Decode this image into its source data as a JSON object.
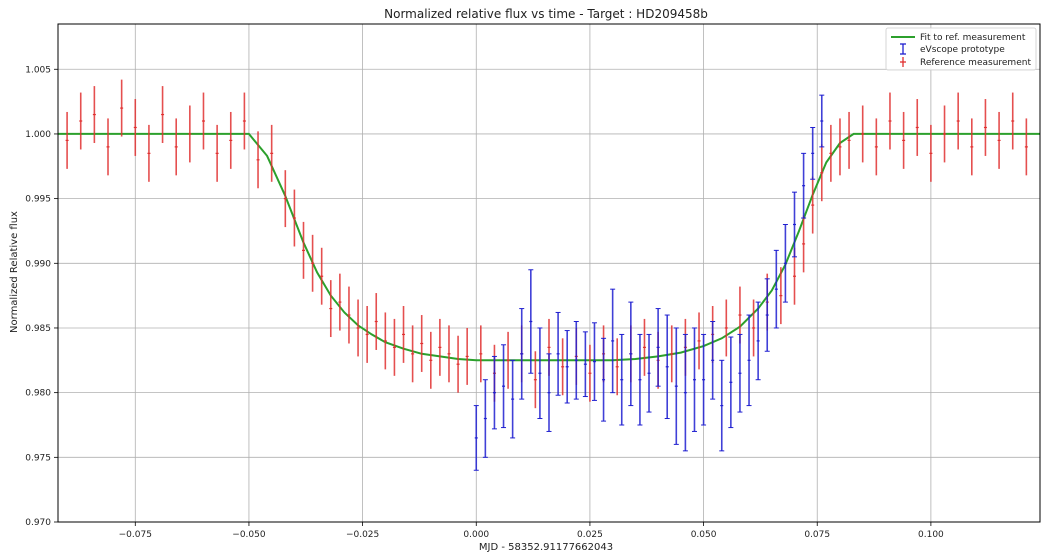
{
  "chart_data": {
    "type": "scatter",
    "title": "Normalized relative flux vs time - Target : HD209458b",
    "xlabel": "MJD - 58352.91177662043",
    "ylabel": "Normalized Relative flux",
    "xlim": [
      -0.092,
      0.124
    ],
    "ylim": [
      0.97,
      1.0085
    ],
    "xticks": [
      -0.075,
      -0.05,
      -0.025,
      0.0,
      0.025,
      0.05,
      0.075,
      0.1
    ],
    "xtick_labels": [
      "−0.075",
      "−0.050",
      "−0.025",
      "0.000",
      "0.025",
      "0.050",
      "0.075",
      "0.100"
    ],
    "yticks": [
      0.97,
      0.975,
      0.98,
      0.985,
      0.99,
      0.995,
      1.0,
      1.005
    ],
    "ytick_labels": [
      "0.970",
      "0.975",
      "0.980",
      "0.985",
      "0.990",
      "0.995",
      "1.000",
      "1.005"
    ],
    "grid": true,
    "legend_position": "top-right",
    "colors": {
      "fit": "#2ca02c",
      "eVscope": "#1f1fd0",
      "reference": "#e03030"
    },
    "series": [
      {
        "name": "Fit to ref. measurement",
        "style": "line",
        "x": [
          -0.092,
          -0.05,
          -0.046,
          -0.042,
          -0.038,
          -0.035,
          -0.032,
          -0.029,
          -0.026,
          -0.023,
          -0.02,
          -0.016,
          -0.012,
          -0.008,
          -0.004,
          0.0,
          0.01,
          0.02,
          0.03,
          0.035,
          0.04,
          0.045,
          0.05,
          0.054,
          0.058,
          0.062,
          0.065,
          0.068,
          0.071,
          0.074,
          0.077,
          0.08,
          0.083,
          0.124
        ],
        "y": [
          1.0,
          1.0,
          0.9983,
          0.9952,
          0.9916,
          0.9893,
          0.9875,
          0.9862,
          0.9852,
          0.9845,
          0.9839,
          0.9834,
          0.983,
          0.9828,
          0.9826,
          0.9825,
          0.9825,
          0.9825,
          0.9825,
          0.9826,
          0.9828,
          0.9831,
          0.9836,
          0.9842,
          0.9851,
          0.9865,
          0.9879,
          0.9899,
          0.9925,
          0.9953,
          0.9978,
          0.9993,
          1.0,
          1.0
        ]
      },
      {
        "name": "eVscope prototype",
        "style": "errorbar",
        "x": [
          0.0,
          0.002,
          0.004,
          0.006,
          0.008,
          0.01,
          0.012,
          0.014,
          0.016,
          0.018,
          0.02,
          0.022,
          0.024,
          0.026,
          0.028,
          0.03,
          0.032,
          0.034,
          0.036,
          0.038,
          0.04,
          0.042,
          0.044,
          0.046,
          0.048,
          0.05,
          0.052,
          0.054,
          0.056,
          0.058,
          0.06,
          0.062,
          0.064,
          0.066,
          0.068,
          0.07,
          0.072,
          0.074,
          0.076
        ],
        "y": [
          0.9765,
          0.978,
          0.98,
          0.9805,
          0.9795,
          0.983,
          0.9855,
          0.9815,
          0.98,
          0.983,
          0.982,
          0.9825,
          0.9822,
          0.9824,
          0.981,
          0.984,
          0.981,
          0.983,
          0.981,
          0.9815,
          0.9835,
          0.982,
          0.9805,
          0.98,
          0.981,
          0.981,
          0.9825,
          0.979,
          0.9808,
          0.9815,
          0.9825,
          0.984,
          0.986,
          0.988,
          0.99,
          0.993,
          0.996,
          0.9985,
          1.001
        ],
        "yerr": [
          0.0025,
          0.003,
          0.0028,
          0.0032,
          0.003,
          0.0035,
          0.004,
          0.0035,
          0.003,
          0.0032,
          0.0028,
          0.003,
          0.0025,
          0.003,
          0.0032,
          0.004,
          0.0035,
          0.004,
          0.0035,
          0.003,
          0.003,
          0.004,
          0.0045,
          0.0045,
          0.004,
          0.0035,
          0.003,
          0.0035,
          0.0035,
          0.003,
          0.0035,
          0.003,
          0.0028,
          0.003,
          0.003,
          0.0025,
          0.0025,
          0.002,
          0.002
        ]
      },
      {
        "name": "Reference measurement",
        "style": "errorbar",
        "x": [
          -0.09,
          -0.087,
          -0.084,
          -0.081,
          -0.078,
          -0.075,
          -0.072,
          -0.069,
          -0.066,
          -0.063,
          -0.06,
          -0.057,
          -0.054,
          -0.051,
          -0.048,
          -0.045,
          -0.042,
          -0.04,
          -0.038,
          -0.036,
          -0.034,
          -0.032,
          -0.03,
          -0.028,
          -0.026,
          -0.024,
          -0.022,
          -0.02,
          -0.018,
          -0.016,
          -0.014,
          -0.012,
          -0.01,
          -0.008,
          -0.006,
          -0.004,
          -0.002,
          0.001,
          0.004,
          0.007,
          0.01,
          0.013,
          0.016,
          0.019,
          0.022,
          0.025,
          0.028,
          0.031,
          0.034,
          0.037,
          0.04,
          0.043,
          0.046,
          0.049,
          0.052,
          0.055,
          0.058,
          0.061,
          0.064,
          0.067,
          0.07,
          0.072,
          0.074,
          0.076,
          0.078,
          0.08,
          0.082,
          0.085,
          0.088,
          0.091,
          0.094,
          0.097,
          0.1,
          0.103,
          0.106,
          0.109,
          0.112,
          0.115,
          0.118,
          0.121
        ],
        "y": [
          0.9995,
          1.001,
          1.0015,
          0.999,
          1.002,
          1.0005,
          0.9985,
          1.0015,
          0.999,
          1.0,
          1.001,
          0.9985,
          0.9995,
          1.001,
          0.998,
          0.9985,
          0.995,
          0.9935,
          0.991,
          0.99,
          0.989,
          0.9865,
          0.987,
          0.986,
          0.985,
          0.9845,
          0.9855,
          0.984,
          0.9835,
          0.9845,
          0.983,
          0.9838,
          0.9825,
          0.9835,
          0.983,
          0.9822,
          0.9828,
          0.983,
          0.9815,
          0.9825,
          0.983,
          0.981,
          0.9835,
          0.982,
          0.9828,
          0.9815,
          0.983,
          0.982,
          0.983,
          0.9835,
          0.9825,
          0.983,
          0.9835,
          0.984,
          0.9845,
          0.985,
          0.986,
          0.985,
          0.987,
          0.9875,
          0.989,
          0.9915,
          0.9945,
          0.997,
          0.9985,
          0.999,
          0.9995,
          1.0,
          0.999,
          1.001,
          0.9995,
          1.0005,
          0.9985,
          1.0,
          1.001,
          0.999,
          1.0005,
          0.9995,
          1.001,
          0.999
        ],
        "yerr": [
          0.0022,
          0.0022,
          0.0022,
          0.0022,
          0.0022,
          0.0022,
          0.0022,
          0.0022,
          0.0022,
          0.0022,
          0.0022,
          0.0022,
          0.0022,
          0.0022,
          0.0022,
          0.0022,
          0.0022,
          0.0022,
          0.0022,
          0.0022,
          0.0022,
          0.0022,
          0.0022,
          0.0022,
          0.0022,
          0.0022,
          0.0022,
          0.0022,
          0.0022,
          0.0022,
          0.0022,
          0.0022,
          0.0022,
          0.0022,
          0.0022,
          0.0022,
          0.0022,
          0.0022,
          0.0022,
          0.0022,
          0.0022,
          0.0022,
          0.0022,
          0.0022,
          0.0022,
          0.0022,
          0.0022,
          0.0022,
          0.0022,
          0.0022,
          0.0022,
          0.0022,
          0.0022,
          0.0022,
          0.0022,
          0.0022,
          0.0022,
          0.0022,
          0.0022,
          0.0022,
          0.0022,
          0.0022,
          0.0022,
          0.0022,
          0.0022,
          0.0022,
          0.0022,
          0.0022,
          0.0022,
          0.0022,
          0.0022,
          0.0022,
          0.0022,
          0.0022,
          0.0022,
          0.0022,
          0.0022,
          0.0022,
          0.0022,
          0.0022
        ]
      }
    ]
  }
}
